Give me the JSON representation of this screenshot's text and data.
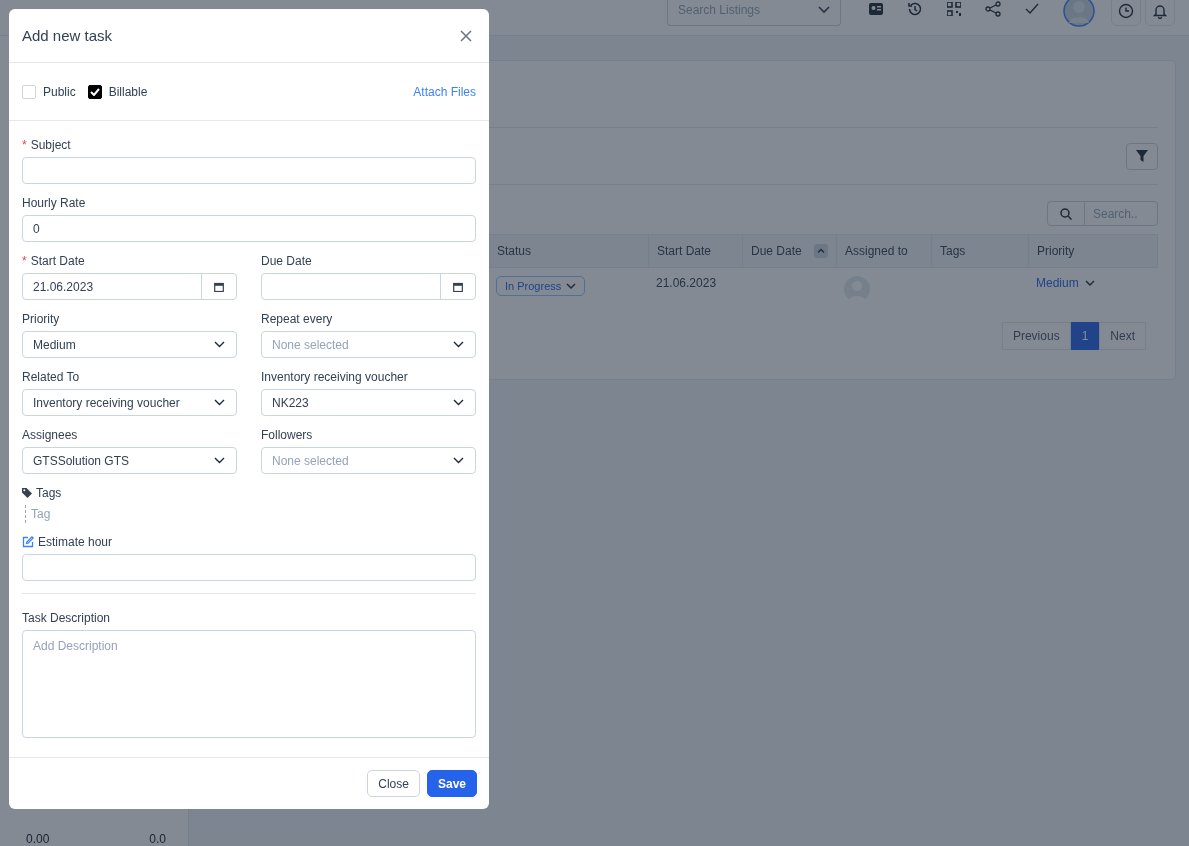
{
  "header": {
    "search_placeholder": "Search Listings"
  },
  "filter_button": {
    "kind": "filter"
  },
  "table_search": {
    "placeholder": "Search.."
  },
  "table": {
    "columns": [
      "Status",
      "Start Date",
      "Due Date",
      "Assigned to",
      "Tags",
      "Priority"
    ],
    "rows": [
      {
        "status": "In Progress",
        "start_date": "21.06.2023",
        "priority": "Medium"
      }
    ]
  },
  "pagination": {
    "previous": "Previous",
    "pages": [
      {
        "label": "1",
        "selected": true
      }
    ],
    "next": "Next"
  },
  "sidebar_totals": [
    "0.00",
    "0.0"
  ],
  "modal": {
    "title": "Add new task",
    "checkboxes": [
      {
        "label": "Public",
        "checked": false
      },
      {
        "label": "Billable",
        "checked": true
      }
    ],
    "attach_link": "Attach Files",
    "rows": [
      [
        {
          "kind": "text",
          "label": "Subject",
          "required_mark": "*"
        }
      ],
      [
        {
          "kind": "text",
          "label": "Hourly Rate",
          "value": "0"
        }
      ],
      [
        {
          "kind": "date",
          "label": "Start Date",
          "required_mark": "*",
          "value": "21.06.2023"
        },
        {
          "kind": "date",
          "label": "Due Date"
        }
      ],
      [
        {
          "kind": "select",
          "label": "Priority",
          "value": "Medium"
        },
        {
          "kind": "select",
          "label": "Repeat every",
          "placeholder": "None selected"
        }
      ],
      [
        {
          "kind": "select",
          "label": "Related To",
          "value": "Inventory receiving voucher"
        },
        {
          "kind": "select",
          "label": "Inventory receiving voucher",
          "value": "NK223"
        }
      ],
      [
        {
          "kind": "select",
          "label": "Assignees",
          "value": "GTSSolution GTS"
        },
        {
          "kind": "select",
          "label": "Followers",
          "placeholder": "None selected"
        }
      ],
      [
        {
          "kind": "tags",
          "label": "Tags",
          "placeholder": "Tag"
        }
      ],
      [
        {
          "kind": "hours",
          "label": "Estimate hour"
        }
      ]
    ],
    "description": {
      "label": "Task Description",
      "placeholder": "Add Description"
    },
    "buttons": [
      {
        "label": "Close",
        "kind": "secondary"
      },
      {
        "label": "Save",
        "kind": "primary"
      }
    ]
  }
}
